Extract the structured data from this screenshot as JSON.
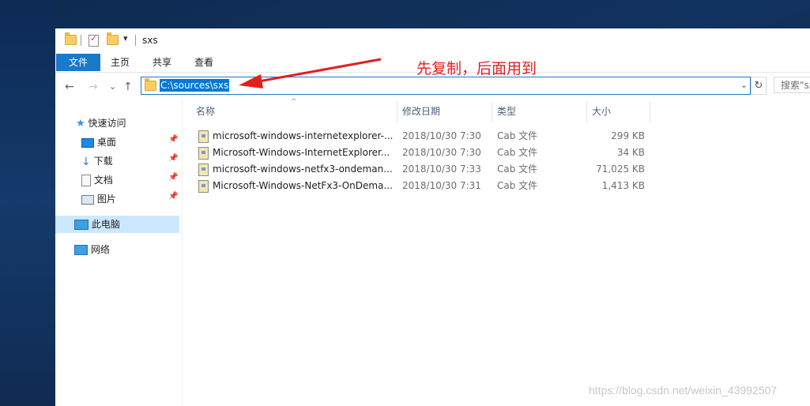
{
  "window": {
    "title": "sxs",
    "qa_dropdown": "▾"
  },
  "ribbon": {
    "tabs": [
      "文件",
      "主页",
      "共享",
      "查看"
    ]
  },
  "address": {
    "path": "C:\\sources\\sxs",
    "dropdown": "⌄",
    "refresh": "↻",
    "search_placeholder": "搜索\"sxs\""
  },
  "nav_buttons": {
    "back": "←",
    "forward": "→",
    "recent": "⌄",
    "up": "↑"
  },
  "nav_pane": {
    "quick_access": "快速访问",
    "items": [
      {
        "label": "桌面",
        "pinned": true
      },
      {
        "label": "下载",
        "pinned": true
      },
      {
        "label": "文档",
        "pinned": true
      },
      {
        "label": "图片",
        "pinned": true
      }
    ],
    "this_pc": "此电脑",
    "network": "网络",
    "pin_glyph": "📌"
  },
  "columns": {
    "name": "名称",
    "modified": "修改日期",
    "type": "类型",
    "size": "大小",
    "sort_caret": "^"
  },
  "files": [
    {
      "name": "microsoft-windows-internetexplorer-...",
      "modified": "2018/10/30 7:30",
      "type": "Cab 文件",
      "size": "299 KB"
    },
    {
      "name": "Microsoft-Windows-InternetExplorer...",
      "modified": "2018/10/30 7:30",
      "type": "Cab 文件",
      "size": "34 KB"
    },
    {
      "name": "microsoft-windows-netfx3-ondeman...",
      "modified": "2018/10/30 7:33",
      "type": "Cab 文件",
      "size": "71,025 KB"
    },
    {
      "name": "Microsoft-Windows-NetFx3-OnDema...",
      "modified": "2018/10/30 7:31",
      "type": "Cab 文件",
      "size": "1,413 KB"
    }
  ],
  "annotation": {
    "text": "先复制，后面用到",
    "color": "#e02020"
  },
  "watermark": "https://blog.csdn.net/weixin_43992507",
  "colors": {
    "accent": "#1979ca",
    "selection": "#0078d7",
    "nav_selected": "#cce8ff"
  }
}
